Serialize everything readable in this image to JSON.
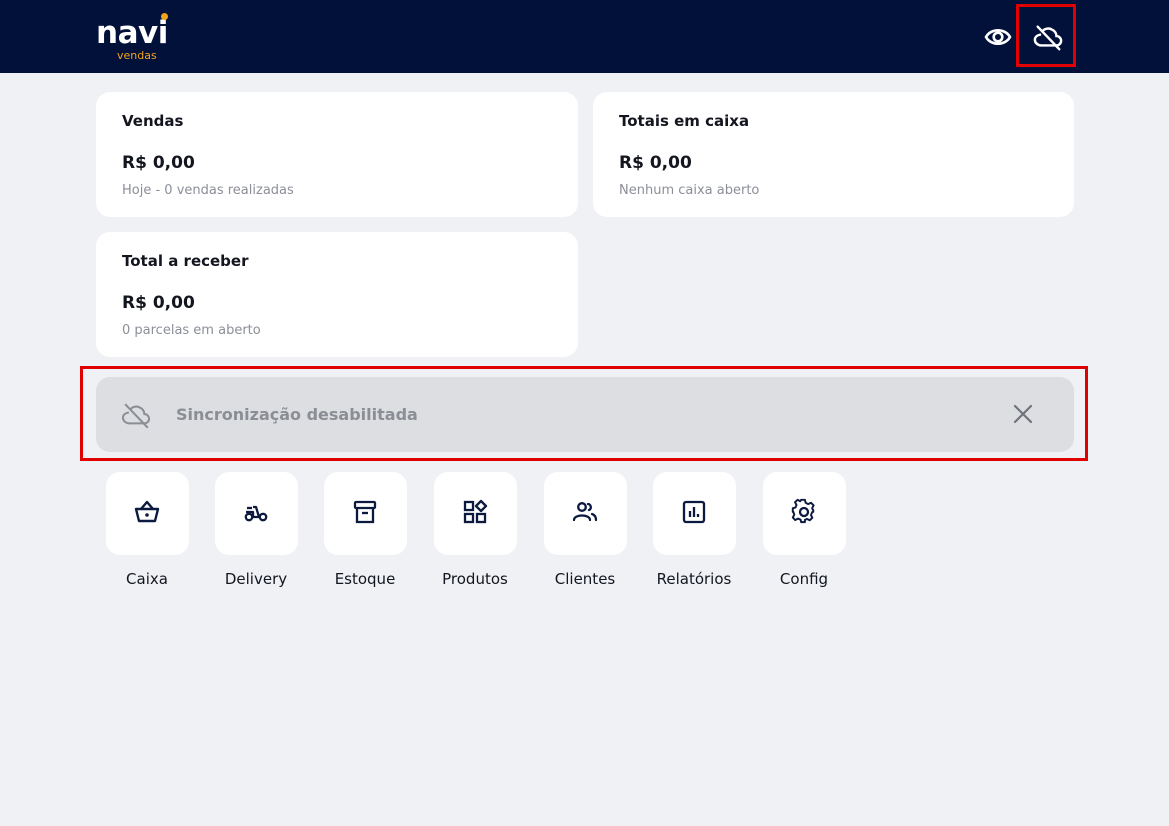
{
  "header": {
    "logo_text": "navi",
    "logo_subtext": "vendas",
    "icons": [
      "eye-icon",
      "cloud-off-icon"
    ]
  },
  "cards": {
    "vendas": {
      "title": "Vendas",
      "value": "R$ 0,00",
      "subtitle": "Hoje - 0 vendas realizadas"
    },
    "totais": {
      "title": "Totais em caixa",
      "value": "R$ 0,00",
      "subtitle": "Nenhum caixa aberto"
    },
    "receber": {
      "title": "Total a receber",
      "value": "R$ 0,00",
      "subtitle": "0 parcelas em aberto"
    }
  },
  "sync_banner": {
    "text": "Sincronização desabilitada",
    "icon": "cloud-off-icon",
    "close_icon": "close-icon"
  },
  "shortcuts": [
    {
      "label": "Caixa",
      "icon": "basket-icon"
    },
    {
      "label": "Delivery",
      "icon": "scooter-icon"
    },
    {
      "label": "Estoque",
      "icon": "archive-box-icon"
    },
    {
      "label": "Produtos",
      "icon": "category-icon"
    },
    {
      "label": "Clientes",
      "icon": "people-icon"
    },
    {
      "label": "Relatórios",
      "icon": "chart-icon"
    },
    {
      "label": "Config",
      "icon": "gear-icon"
    }
  ],
  "colors": {
    "header_bg": "#01113a",
    "accent": "#f2a31b",
    "page_bg": "#eff1f5",
    "highlight": "#e00000"
  }
}
